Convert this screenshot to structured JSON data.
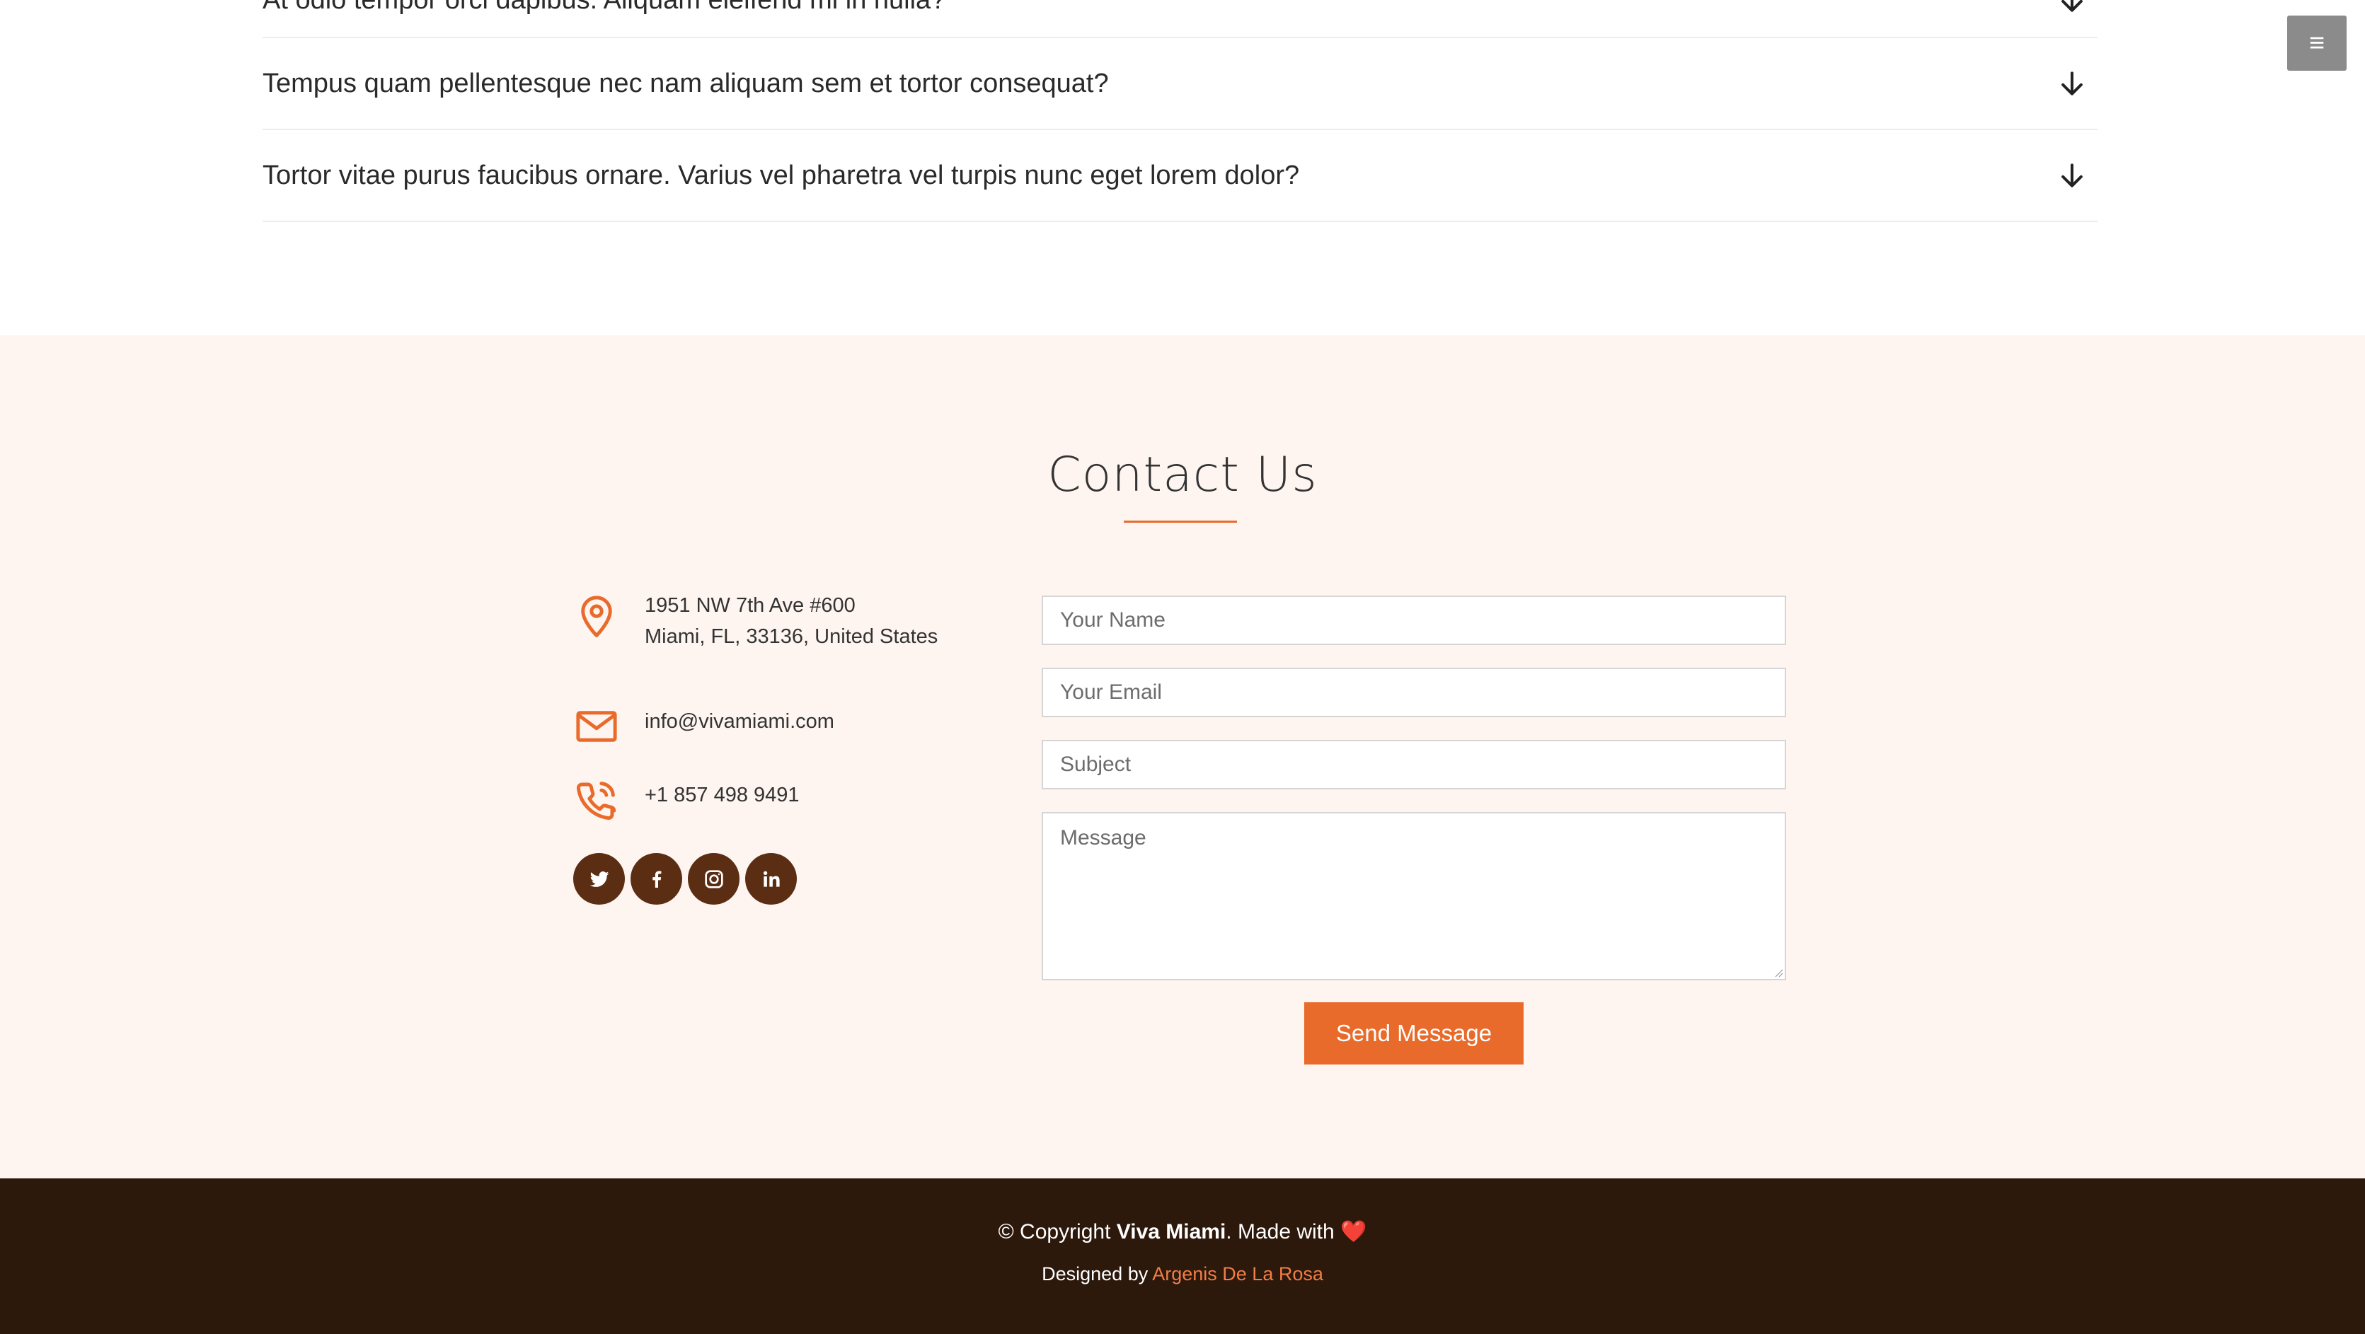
{
  "faq": {
    "items": [
      {
        "question": "At odio tempor orci dapibus. Aliquam eleifend mi in nulla?"
      },
      {
        "question": "Tempus quam pellentesque nec nam aliquam sem et tortor consequat?"
      },
      {
        "question": "Tortor vitae purus faucibus ornare. Varius vel pharetra vel turpis nunc eget lorem dolor?"
      }
    ]
  },
  "menu_toggle": {
    "icon": "hamburger-icon",
    "glyph": "≡"
  },
  "contact": {
    "title": "Contact Us",
    "address_line1": "1951 NW 7th Ave #600",
    "address_line2": "Miami, FL, 33136, United States",
    "email": "info@vivamiami.com",
    "phone": "+1 857 498 9491",
    "socials": [
      "twitter-icon",
      "facebook-icon",
      "instagram-icon",
      "linkedin-icon"
    ],
    "form": {
      "name_placeholder": "Your Name",
      "email_placeholder": "Your Email",
      "subject_placeholder": "Subject",
      "message_placeholder": "Message",
      "submit_label": "Send Message"
    }
  },
  "footer": {
    "copyright_prefix": "© Copyright ",
    "brand": "Viva Miami",
    "copyright_suffix": ". Made with ",
    "heart": "❤️",
    "designed_prefix": "Designed by ",
    "designer": "Argenis De La Rosa"
  },
  "colors": {
    "accent": "#e96b2c",
    "social_bg": "#5b2e14",
    "contact_bg": "#fef5f1",
    "footer_bg": "#2d180c",
    "menu_toggle_bg": "#8b8b8b"
  }
}
